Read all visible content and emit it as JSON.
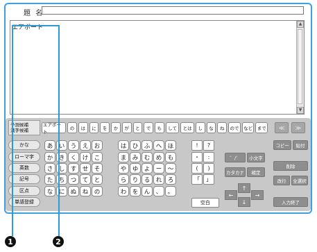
{
  "title_field": {
    "label": "題 名",
    "value": ""
  },
  "text_area": {
    "content": "エアポート"
  },
  "candidate_panel": {
    "label_lines": [
      "予測候補",
      "漢字候補"
    ],
    "candidates": [
      "エアポート",
      "の",
      "は",
      "に",
      "を",
      "か",
      "が",
      "と",
      "で",
      "も",
      "して",
      "とは",
      "し",
      "な",
      "ね",
      "ので",
      "など",
      "まで"
    ],
    "prev": "≪",
    "next": "≫"
  },
  "modes": [
    "かな",
    "ローマ字",
    "英数",
    "記号",
    "区点",
    "単語登録"
  ],
  "kana_rows": [
    [
      "あ",
      "い",
      "う",
      "え",
      "お",
      "は",
      "ひ",
      "ふ",
      "へ",
      "ほ"
    ],
    [
      "か",
      "き",
      "く",
      "け",
      "こ",
      "ま",
      "み",
      "む",
      "め",
      "も"
    ],
    [
      "さ",
      "し",
      "す",
      "せ",
      "そ",
      "や",
      "ゆ",
      "よ",
      "ー",
      "〜"
    ],
    [
      "た",
      "ち",
      "つ",
      "て",
      "と",
      "ら",
      "り",
      "る",
      "れ",
      "ろ"
    ],
    [
      "な",
      "に",
      "ぬ",
      "ね",
      "の",
      "わ",
      "を",
      "ん",
      "、",
      "。"
    ]
  ],
  "symbols": [
    [
      "!",
      "?"
    ],
    [
      "・",
      ":"
    ],
    [
      "(",
      ")"
    ],
    [
      "「",
      "」"
    ]
  ],
  "function_keys": {
    "dakuten": "゛/゜",
    "small": "小文字",
    "katakana": "カタカナ",
    "confirm": "確定",
    "copy": "コピー",
    "paste": "貼付",
    "delete": "削除",
    "newline": "改行",
    "select_all": "全選択",
    "finish": "入力終了",
    "space": "空白"
  },
  "arrows": {
    "up": "↑",
    "down": "↓",
    "left": "←",
    "right": "→"
  },
  "callouts": [
    "1",
    "2"
  ]
}
